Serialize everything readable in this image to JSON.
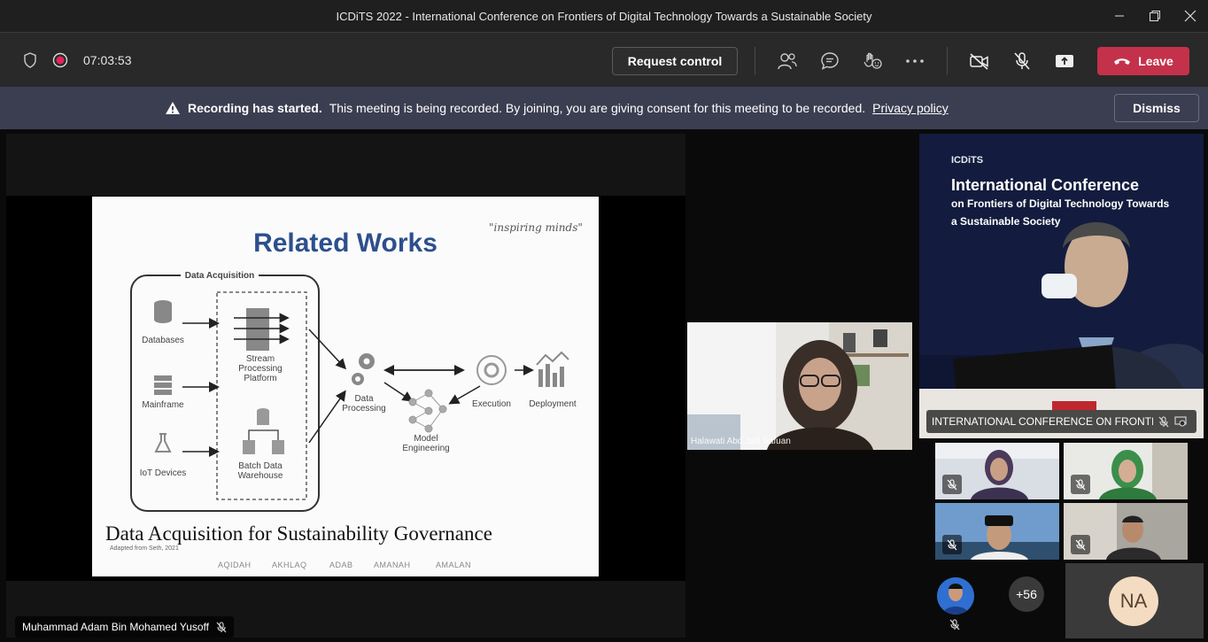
{
  "window": {
    "title": "ICDiTS 2022 - International Conference on Frontiers of Digital Technology Towards a Sustainable Society"
  },
  "toolbar": {
    "timer": "07:03:53",
    "request_control_label": "Request control",
    "leave_label": "Leave"
  },
  "banner": {
    "bold": "Recording has started.",
    "text": "This meeting is being recorded. By joining, you are giving consent for this meeting to be recorded.",
    "link": "Privacy policy",
    "dismiss_label": "Dismiss"
  },
  "slide": {
    "title": "Related Works",
    "quote": "\"inspiring minds\"",
    "group_label": "Data Acquisition",
    "sources": [
      "Databases",
      "Mainframe",
      "IoT Devices"
    ],
    "stream": "Stream Processing Platform",
    "batch": "Batch Data Warehouse",
    "processing": "Data Processing",
    "model": "Model Engineering",
    "execution": "Execution",
    "deployment": "Deployment",
    "footer": "Data Acquisition for Sustainability Governance",
    "citation": "Adapted from Seth, 2021",
    "values": [
      "AQIDAH",
      "AKHLAQ",
      "ADAB",
      "AMANAH",
      "AMALAN"
    ]
  },
  "presenter": {
    "name": "Muhammad Adam Bin Mohamed Yusoff"
  },
  "tiles": {
    "center_name": "Halawati Abd Jalil Safuan",
    "conference_name": "INTERNATIONAL CONFERENCE ON FRONTI...",
    "conference_screen": {
      "brand": "ICDiTS",
      "line1": "International Conference",
      "line2": "on Frontiers of Digital Technology Towards",
      "line3": "a Sustainable Society"
    },
    "more_count": "+56",
    "na_initials": "NA"
  },
  "colors": {
    "leave": "#c4314b",
    "banner": "#3b3e51",
    "slide_title": "#2d4f8c",
    "na_avatar": "#f3dcc2"
  }
}
